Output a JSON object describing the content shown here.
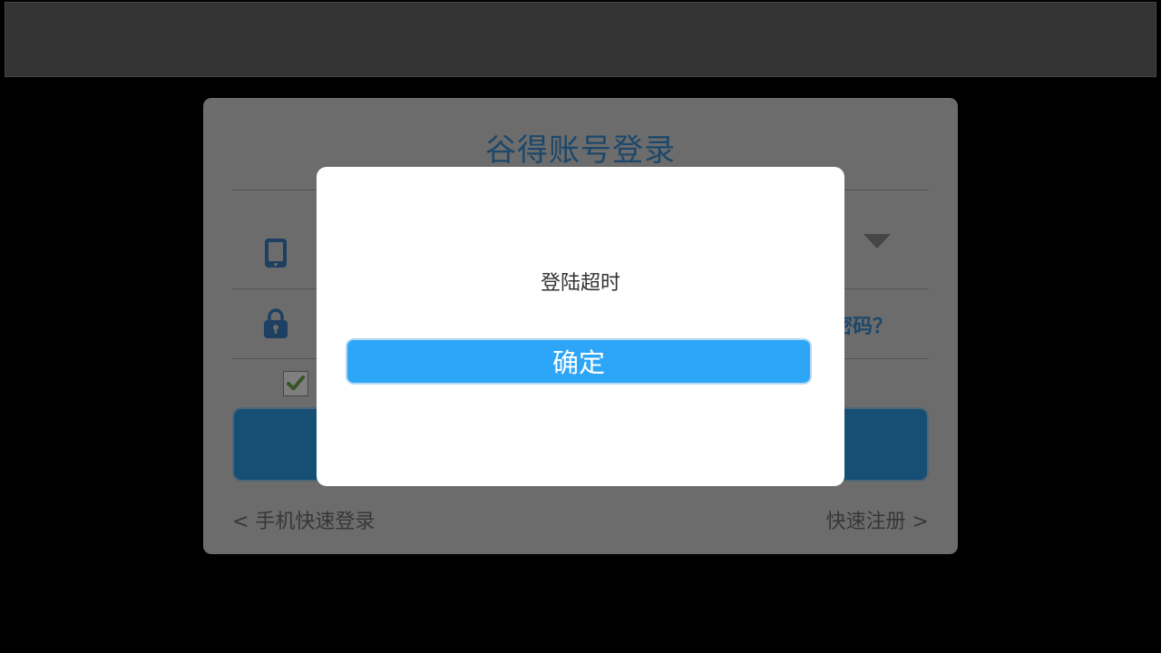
{
  "login_card": {
    "title": "谷得账号登录",
    "forgot_password_label": "密码？",
    "phone_quick_login_label": "< 手机快速登录",
    "quick_register_label": "快速注册 >"
  },
  "modal": {
    "message": "登陆超时",
    "confirm_label": "确定"
  },
  "icons": {
    "phone": "phone-icon",
    "lock": "lock-icon",
    "dropdown": "chevron-down-icon",
    "checkmark": "checkmark-icon"
  },
  "colors": {
    "accent_blue": "#2ea6f8",
    "title_blue": "#3a8fd4",
    "checkmark_green": "#6aa84f",
    "icon_blue": "#3a7fc4"
  }
}
